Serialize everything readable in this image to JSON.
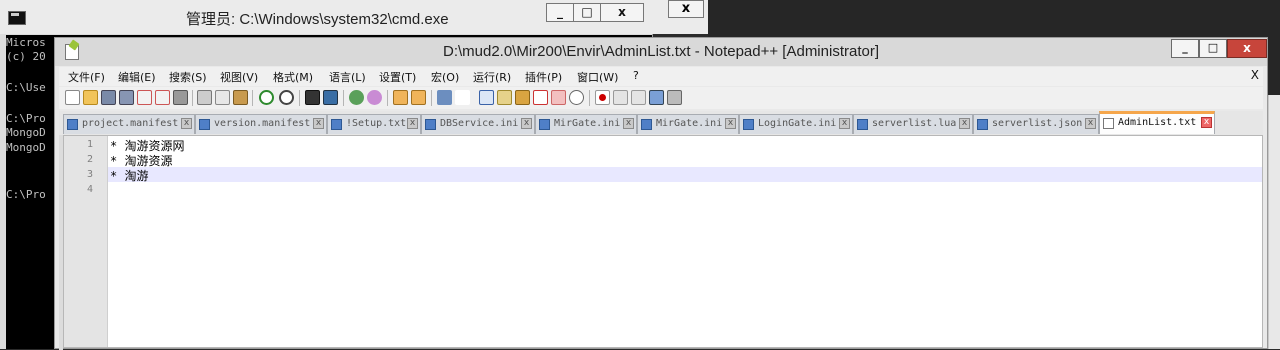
{
  "cmd": {
    "title": "管理员: C:\\Windows\\system32\\cmd.exe",
    "min": "_",
    "max": "□",
    "close": "x",
    "close_extra": "x",
    "lines": [
      "Micros",
      "(c) 20",
      "C:\\Use",
      "C:\\Pro",
      "MongoD",
      "MongoD",
      "C:\\Pro"
    ]
  },
  "npp": {
    "title": "D:\\mud2.0\\Mir200\\Envir\\AdminList.txt - Notepad++ [Administrator]",
    "min": "_",
    "max": "□",
    "close": "x",
    "menu": [
      "文件(F)",
      "编辑(E)",
      "搜索(S)",
      "视图(V)",
      "格式(M)",
      "语言(L)",
      "设置(T)",
      "宏(O)",
      "运行(R)",
      "插件(P)",
      "窗口(W)",
      "?"
    ],
    "menu_close": "X",
    "tabs": [
      {
        "label": "project.manifest"
      },
      {
        "label": "version.manifest"
      },
      {
        "label": "!Setup.txt"
      },
      {
        "label": "DBService.ini"
      },
      {
        "label": "MirGate.ini"
      },
      {
        "label": "MirGate.ini"
      },
      {
        "label": "LoginGate.ini"
      },
      {
        "label": "serverlist.lua"
      },
      {
        "label": "serverlist.json"
      },
      {
        "label": "AdminList.txt"
      }
    ],
    "tab_close": "x",
    "lines": [
      {
        "num": "1",
        "text": "* 淘游资源网"
      },
      {
        "num": "2",
        "text": "* 淘游资源"
      },
      {
        "num": "3",
        "text": "* 淘游"
      },
      {
        "num": "4",
        "text": ""
      }
    ]
  },
  "colors": {
    "accent_tab": "#f5a64b",
    "close_red": "#c7453b"
  }
}
